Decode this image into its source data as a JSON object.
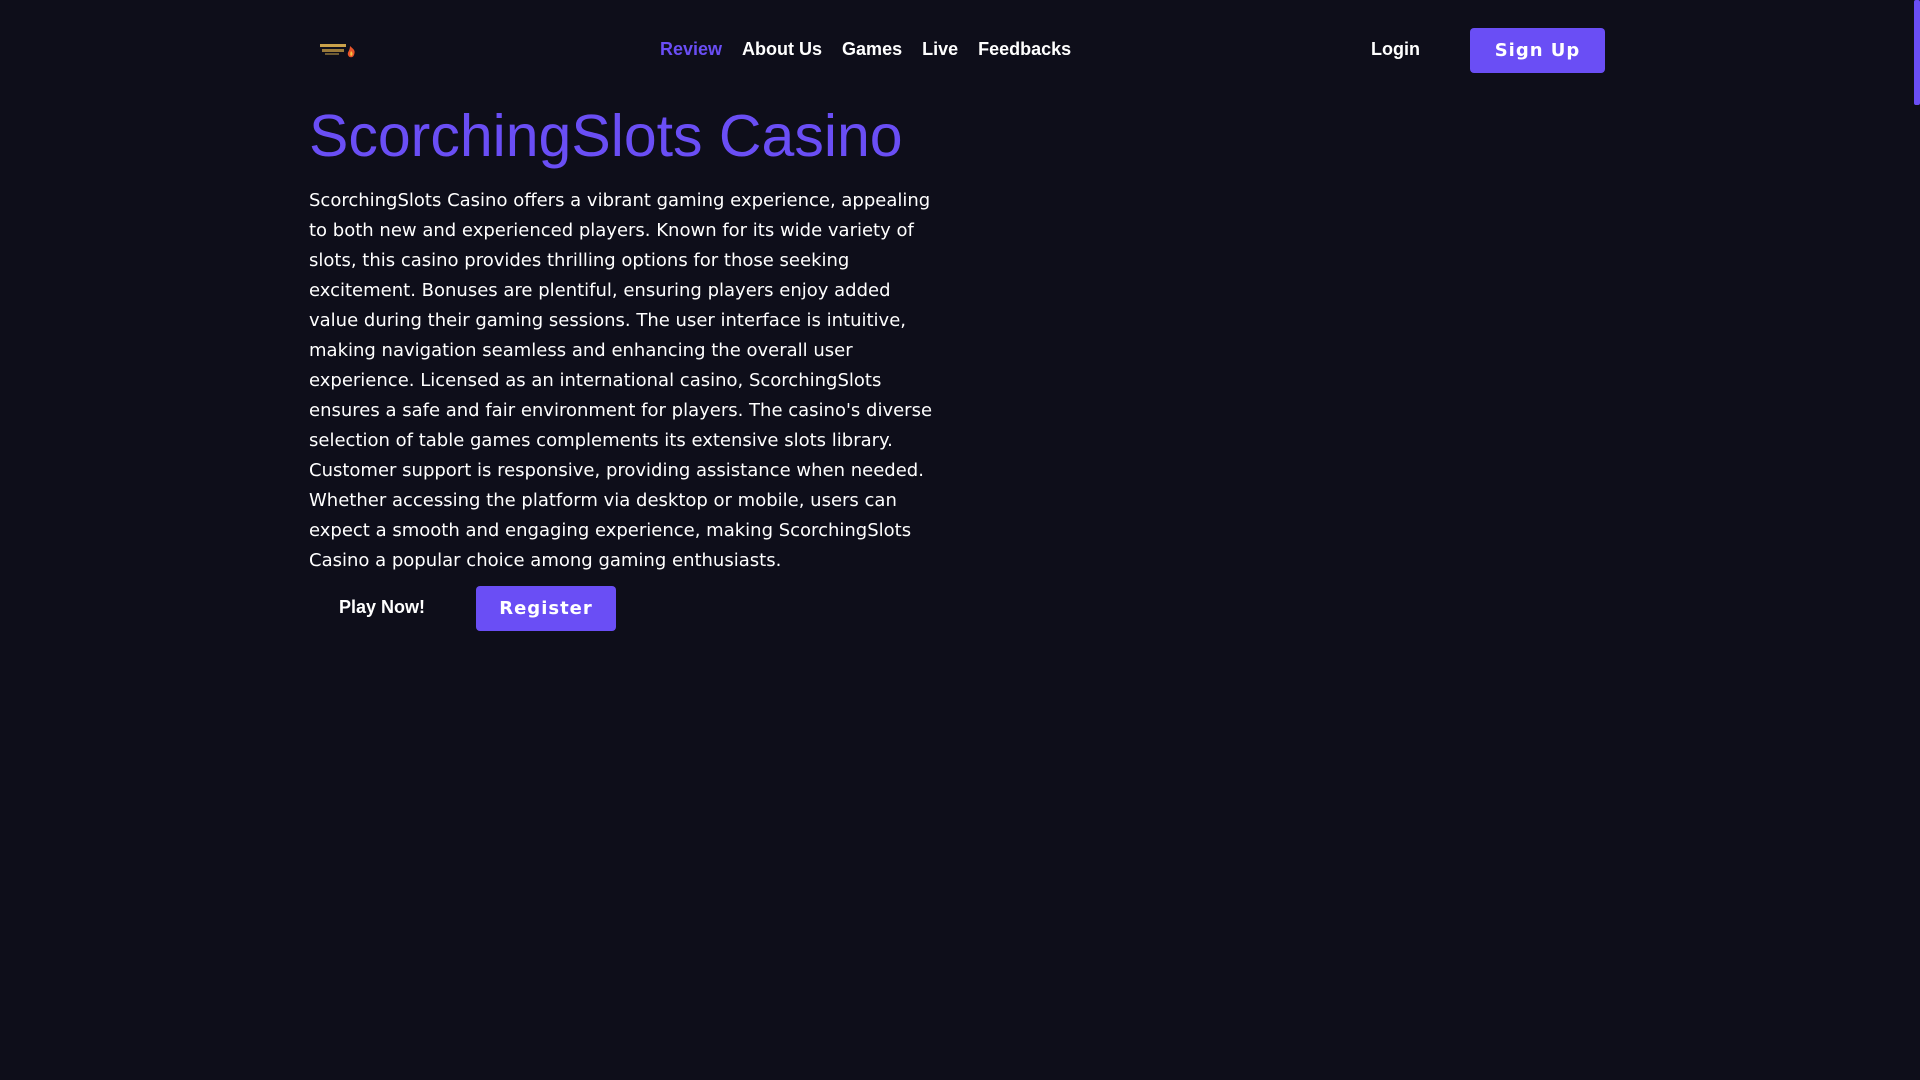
{
  "header": {
    "logo_icon": "scorchingslots-logo",
    "nav": [
      {
        "label": "Review",
        "active": true
      },
      {
        "label": "About Us",
        "active": false
      },
      {
        "label": "Games",
        "active": false
      },
      {
        "label": "Live",
        "active": false
      },
      {
        "label": "Feedbacks",
        "active": false
      }
    ],
    "login_label": "Login",
    "signup_label": "Sign Up"
  },
  "main": {
    "title": "ScorchingSlots Casino",
    "description": "ScorchingSlots Casino offers a vibrant gaming experience, appealing to both new and experienced players. Known for its wide variety of slots, this casino provides thrilling options for those seeking excitement. Bonuses are plentiful, ensuring players enjoy added value during their gaming sessions. The user interface is intuitive, making navigation seamless and enhancing the overall user experience. Licensed as an international casino, ScorchingSlots ensures a safe and fair environment for players. The casino's diverse selection of table games complements its extensive slots library. Customer support is responsive, providing assistance when needed. Whether accessing the platform via desktop or mobile, users can expect a smooth and engaging experience, making ScorchingSlots Casino a popular choice among gaming enthusiasts.",
    "play_label": "Play Now!",
    "register_label": "Register"
  },
  "colors": {
    "background": "#0e0e1a",
    "accent": "#6a4ef5",
    "text": "#ffffff"
  }
}
